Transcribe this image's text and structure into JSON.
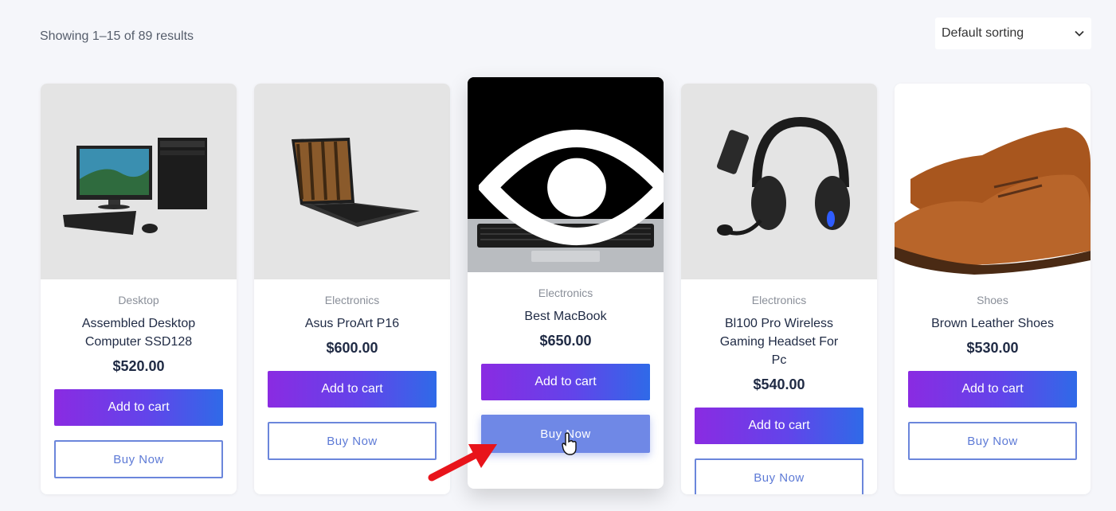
{
  "toolbar": {
    "result_count": "Showing 1–15 of 89 results",
    "sort_label": "Default sorting"
  },
  "products": [
    {
      "category": "Desktop",
      "title": "Assembled Desktop Computer SSD128",
      "price": "$520.00",
      "cart_label": "Add to cart",
      "buy_label": "Buy Now"
    },
    {
      "category": "Electronics",
      "title": "Asus ProArt P16",
      "price": "$600.00",
      "cart_label": "Add to cart",
      "buy_label": "Buy Now"
    },
    {
      "category": "Electronics",
      "title": "Best MacBook",
      "price": "$650.00",
      "cart_label": "Add to cart",
      "buy_label": "Buy Now"
    },
    {
      "category": "Electronics",
      "title": "Bl100 Pro Wireless Gaming Headset For Pc",
      "price": "$540.00",
      "cart_label": "Add to cart",
      "buy_label": "Buy Now"
    },
    {
      "category": "Shoes",
      "title": "Brown Leather Shoes",
      "price": "$530.00",
      "cart_label": "Add to cart",
      "buy_label": "Buy Now"
    }
  ],
  "colors": {
    "accent_gradient_start": "#8a2be2",
    "accent_gradient_end": "#2f6ae8",
    "buy_border": "#6b86db",
    "annotation_arrow": "#e8141b"
  },
  "icons": [
    "chevron-down-icon",
    "eye-icon",
    "pointer-cursor-icon"
  ]
}
